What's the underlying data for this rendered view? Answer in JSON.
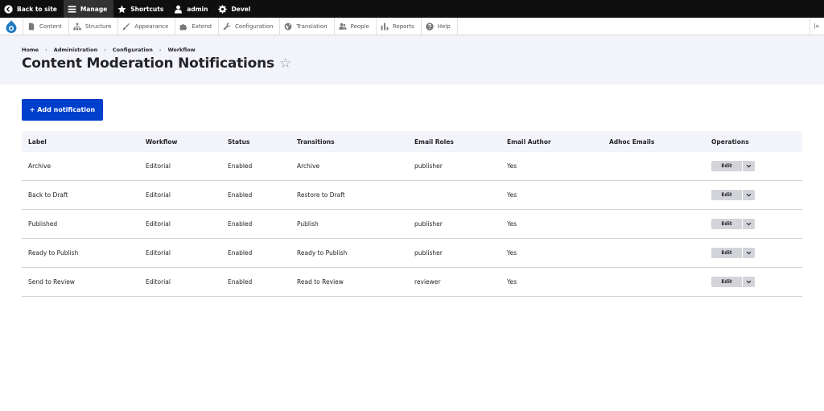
{
  "toolbar": {
    "back_to_site": "Back to site",
    "manage": "Manage",
    "shortcuts": "Shortcuts",
    "user": "admin",
    "devel": "Devel"
  },
  "tray": {
    "items": [
      "Content",
      "Structure",
      "Appearance",
      "Extend",
      "Configuration",
      "Translation",
      "People",
      "Reports",
      "Help"
    ]
  },
  "breadcrumb": [
    "Home",
    "Administration",
    "Configuration",
    "Workflow"
  ],
  "breadcrumb_separator": "›",
  "page_title": "Content Moderation Notifications",
  "star": "☆",
  "add_button": "+ Add notification",
  "table": {
    "headers": [
      "Label",
      "Workflow",
      "Status",
      "Transitions",
      "Email Roles",
      "Email Author",
      "Adhoc Emails",
      "Operations"
    ],
    "rows": [
      {
        "label": "Archive",
        "workflow": "Editorial",
        "status": "Enabled",
        "transitions": "Archive",
        "roles": "publisher",
        "author": "Yes",
        "adhoc": "",
        "op": "Edit"
      },
      {
        "label": "Back to Draft",
        "workflow": "Editorial",
        "status": "Enabled",
        "transitions": "Restore to Draft",
        "roles": "",
        "author": "Yes",
        "adhoc": "",
        "op": "Edit"
      },
      {
        "label": "Published",
        "workflow": "Editorial",
        "status": "Enabled",
        "transitions": "Publish",
        "roles": "publisher",
        "author": "Yes",
        "adhoc": "",
        "op": "Edit"
      },
      {
        "label": "Ready to Publish",
        "workflow": "Editorial",
        "status": "Enabled",
        "transitions": "Ready to Publish",
        "roles": "publisher",
        "author": "Yes",
        "adhoc": "",
        "op": "Edit"
      },
      {
        "label": "Send to Review",
        "workflow": "Editorial",
        "status": "Enabled",
        "transitions": "Read to Review",
        "roles": "reviewer",
        "author": "Yes",
        "adhoc": "",
        "op": "Edit"
      }
    ]
  },
  "colors": {
    "primary": "#003ecc",
    "toolbar": "#0f0f0f",
    "header_bg": "#f3f4f9"
  }
}
